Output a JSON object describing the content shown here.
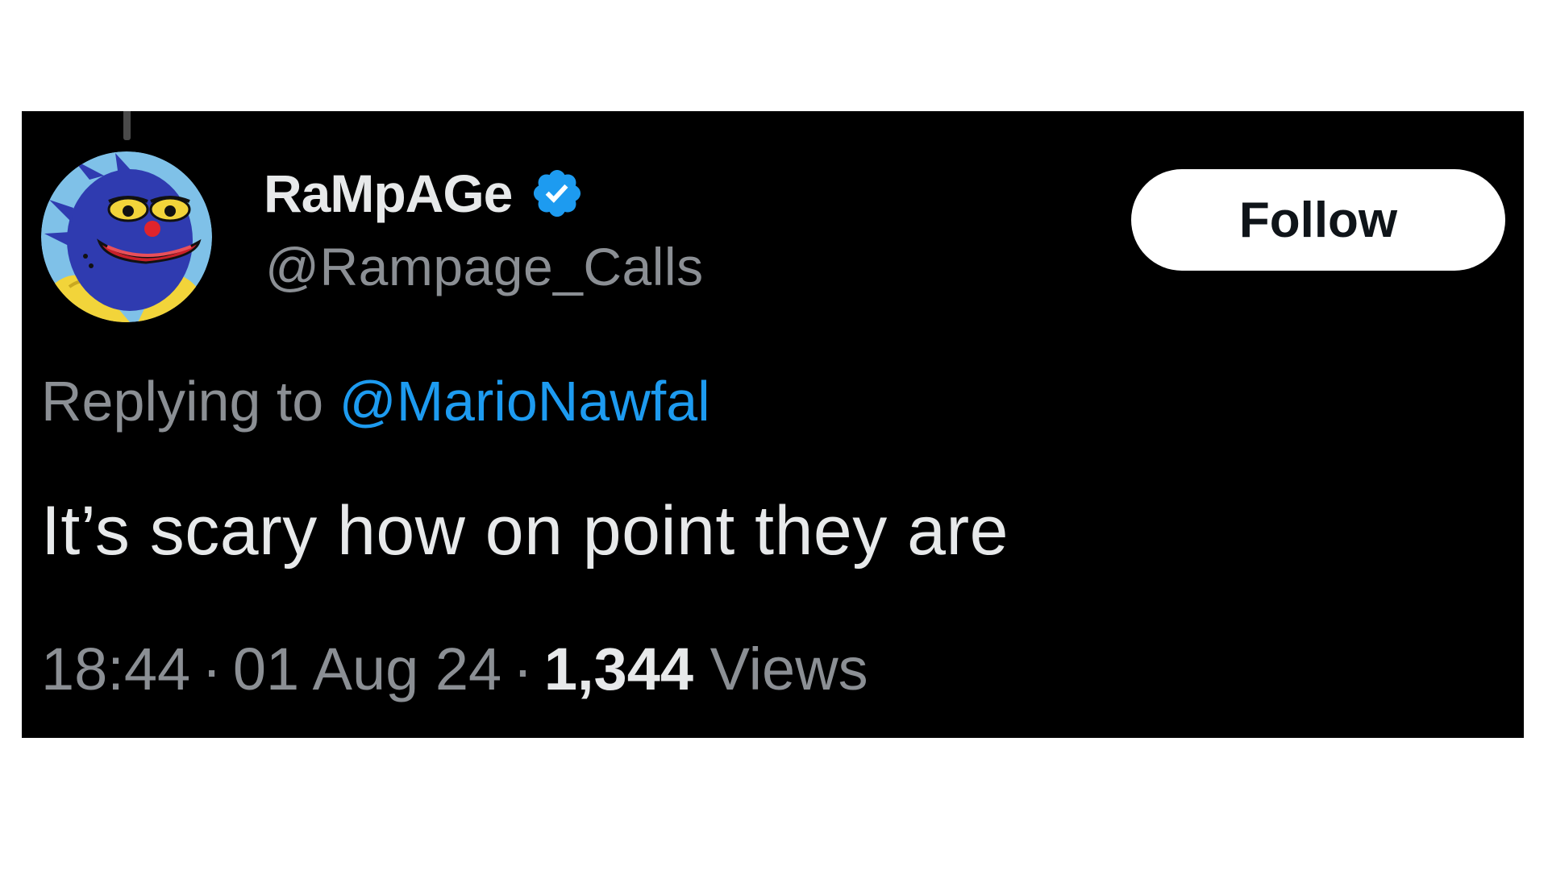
{
  "tweet": {
    "author": {
      "display_name": "RaMpAGe",
      "handle": "@Rampage_Calls",
      "verified": true,
      "avatar_icon": "blue-frog-avatar-icon",
      "verified_icon": "verified-badge-icon"
    },
    "follow_button_label": "Follow",
    "reply": {
      "prefix": "Replying to ",
      "handle": "@MarioNawfal"
    },
    "text": "It’s scary how on point they are",
    "meta": {
      "time": "18:44",
      "date": "01 Aug 24",
      "separator": "·",
      "views_count": "1,344",
      "views_label": "Views"
    }
  },
  "colors": {
    "background": "#000000",
    "primary_text": "#e7e9ea",
    "secondary_text": "#8b8f94",
    "link": "#1d9bf0",
    "verified": "#1d9bf0",
    "follow_button_bg": "#ffffff"
  }
}
